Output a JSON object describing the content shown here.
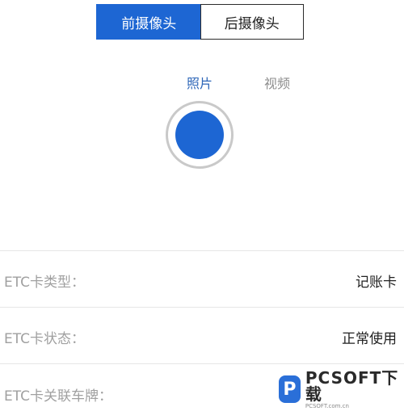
{
  "camera_toggle": {
    "front_label": "前摄像头",
    "rear_label": "后摄像头",
    "selected": "front"
  },
  "mode_tabs": {
    "photo_label": "照片",
    "video_label": "视频",
    "selected": "photo"
  },
  "shutter": {
    "icon": "shutter-button-icon"
  },
  "info_rows": [
    {
      "label": "ETC卡类型：",
      "value": "记账卡"
    },
    {
      "label": "ETC卡状态：",
      "value": "正常使用"
    },
    {
      "label": "ETC卡关联车牌：",
      "value": ""
    }
  ],
  "watermark": {
    "logo_letter": "P",
    "text": "PCSOFT下载",
    "subtext": "PCSOFT.com.cn"
  },
  "colors": {
    "accent": "#1d66d3",
    "active_tab_text": "#2d66b8",
    "inactive_tab_text": "#8e8e8e",
    "label_text": "#a0a0a0",
    "value_text": "#222222"
  }
}
